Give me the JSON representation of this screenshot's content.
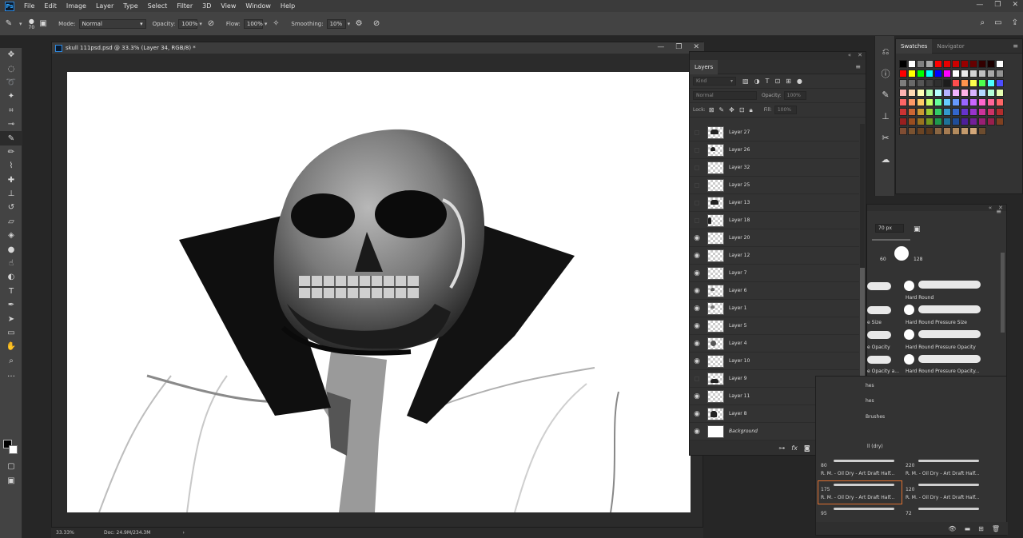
{
  "app": {
    "menu": [
      "File",
      "Edit",
      "Image",
      "Layer",
      "Type",
      "Select",
      "Filter",
      "3D",
      "View",
      "Window",
      "Help"
    ]
  },
  "options": {
    "brush_size": "70",
    "mode_label": "Mode:",
    "mode_value": "Normal",
    "opacity_label": "Opacity:",
    "opacity_value": "100%",
    "flow_label": "Flow:",
    "flow_value": "100%",
    "smoothing_label": "Smoothing:",
    "smoothing_value": "10%"
  },
  "document": {
    "title": "skull 111psd.psd @ 33.3% (Layer 34, RGB/8) *",
    "zoom": "33.33%",
    "doc_info": "Doc: 24.9M/234.3M"
  },
  "layers_panel": {
    "tab_label": "Layers",
    "filter_kind": "Kind",
    "blend_mode": "Normal",
    "opacity_label": "Opacity:",
    "opacity_value": "100%",
    "lock_label": "Lock:",
    "fill_label": "Fill:",
    "fill_value": "100%",
    "layers": [
      {
        "name": "Layer 27",
        "visible": false
      },
      {
        "name": "Layer 26",
        "visible": false
      },
      {
        "name": "Layer 32",
        "visible": false
      },
      {
        "name": "Layer 25",
        "visible": false
      },
      {
        "name": "Layer 13",
        "visible": false
      },
      {
        "name": "Layer 18",
        "visible": false
      },
      {
        "name": "Layer 20",
        "visible": true
      },
      {
        "name": "Layer 12",
        "visible": true
      },
      {
        "name": "Layer 7",
        "visible": true
      },
      {
        "name": "Layer 6",
        "visible": true
      },
      {
        "name": "Layer 1",
        "visible": true
      },
      {
        "name": "Layer 5",
        "visible": true
      },
      {
        "name": "Layer 4",
        "visible": true
      },
      {
        "name": "Layer 10",
        "visible": true
      },
      {
        "name": "Layer 9",
        "visible": false
      },
      {
        "name": "Layer 11",
        "visible": true
      },
      {
        "name": "Layer 8",
        "visible": true
      },
      {
        "name": "Background",
        "visible": true
      }
    ]
  },
  "swatches_panel": {
    "tabs": [
      "Swatches",
      "Navigator"
    ],
    "colors": [
      [
        "#000000",
        "#ffffff",
        "#7f7f7f",
        "#a6a6a6",
        "#ff0000",
        "#e60000",
        "#cc0000",
        "#990000",
        "#660000",
        "#330000",
        "#1a0000",
        "#ffffff"
      ],
      [
        "#ff0000",
        "#ffff00",
        "#00ff00",
        "#00ffff",
        "#0000ff",
        "#ff00ff",
        "#ffffff",
        "#ebebeb",
        "#d4d4d4",
        "#bfbfbf",
        "#a8a8a8",
        "#929292"
      ],
      [
        "#7d7d7d",
        "#696969",
        "#555555",
        "#424242",
        "#2f2f2f",
        "#1c1c1c",
        "#ff4d4d",
        "#ff944d",
        "#ffff4d",
        "#4dff4d",
        "#4dffff",
        "#4d4dff"
      ],
      [
        "#ffb3b3",
        "#ffd9b3",
        "#ffffb3",
        "#b3ffb3",
        "#b3ffff",
        "#b3b3ff",
        "#f2b3ff",
        "#ffb3e6",
        "#d9b3ff",
        "#b3d9ff",
        "#b3ffd9",
        "#e6ffb3"
      ],
      [
        "#ff6666",
        "#ff9966",
        "#ffcc66",
        "#ccff66",
        "#66ff99",
        "#66ccff",
        "#6699ff",
        "#9966ff",
        "#cc66ff",
        "#ff66cc",
        "#ff6699",
        "#ff6666"
      ],
      [
        "#cc3333",
        "#cc6633",
        "#cc9933",
        "#99cc33",
        "#33cc66",
        "#3399cc",
        "#3366cc",
        "#6633cc",
        "#9933cc",
        "#cc3399",
        "#cc3366",
        "#b32d2d"
      ],
      [
        "#991f1f",
        "#994d1f",
        "#99731f",
        "#73991f",
        "#1f994d",
        "#1f7399",
        "#1f4d99",
        "#4d1f99",
        "#731f99",
        "#991f73",
        "#991f4d",
        "#804020"
      ],
      [
        "#804d33",
        "#7a5230",
        "#6b4423",
        "#5c3a1e",
        "#8a6642",
        "#a67c52",
        "#b38b5d",
        "#c49a6c",
        "#d4a87a",
        "#6d4c2e"
      ]
    ]
  },
  "brush_panel": {
    "size_value": "70 px",
    "size_presets": [
      "60",
      "128"
    ],
    "brushes": [
      "Hard Round",
      "Hard Round Pressure Size",
      "Hard Round Pressure Opacity",
      "Hard Round Pressure Opacity..."
    ],
    "partial_labels": [
      "e Size",
      "e Opacity",
      "e Opacity a...",
      "hes",
      "hes",
      "Brushes",
      "ll (dry)"
    ]
  },
  "brush_list": {
    "items": [
      {
        "size": "80",
        "label": "R. M. - Oil Dry - Art Draft Half..."
      },
      {
        "size": "220",
        "label": "R. M. - Oil Dry - Art Draft Half..."
      },
      {
        "size": "175",
        "label": "R. M. - Oil Dry - Art Draft Half..."
      },
      {
        "size": "120",
        "label": "R. M. - Oil Dry - Art Draft Half..."
      },
      {
        "size": "95",
        "label": ""
      },
      {
        "size": "72",
        "label": ""
      }
    ]
  }
}
